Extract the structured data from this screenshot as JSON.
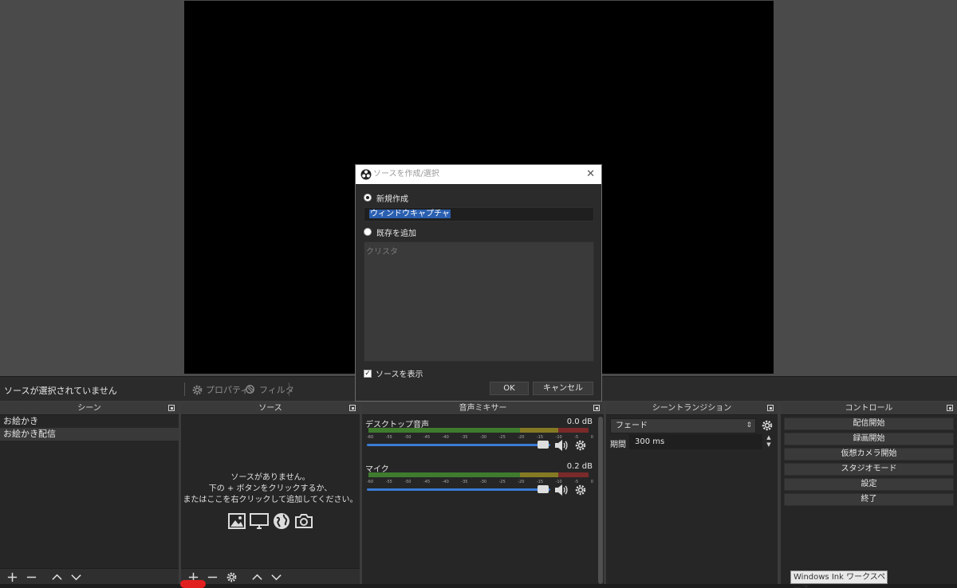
{
  "context_bar": {
    "status": "ソースが選択されていません",
    "properties_label": "プロパティ",
    "filters_label": "フィルタ"
  },
  "docks": {
    "scenes": {
      "title": "シーン",
      "items": [
        "お絵かき",
        "お絵かき配信"
      ],
      "selected_index": 1
    },
    "sources": {
      "title": "ソース",
      "empty_line1": "ソースがありません。",
      "empty_line2": "下の + ボタンをクリックするか、",
      "empty_line3": "またはここを右クリックして追加してください。"
    },
    "mixer": {
      "title": "音声ミキサー",
      "channels": [
        {
          "name": "デスクトップ音声",
          "db": "0.0 dB"
        },
        {
          "name": "マイク",
          "db": "0.2 dB"
        }
      ],
      "ticks": [
        "-60",
        "-55",
        "-50",
        "-45",
        "-40",
        "-35",
        "-30",
        "-25",
        "-20",
        "-15",
        "-10",
        "-5",
        "0"
      ]
    },
    "transitions": {
      "title": "シーントランジション",
      "selected": "フェード",
      "duration_label": "期間",
      "duration_value": "300 ms"
    },
    "controls": {
      "title": "コントロール",
      "buttons": [
        "配信開始",
        "録画開始",
        "仮想カメラ開始",
        "スタジオモード",
        "設定",
        "終了"
      ]
    }
  },
  "dialog": {
    "title": "ソースを作成/選択",
    "close_glyph": "✕",
    "option_new": "新規作成",
    "name_value": "ウィンドウキャプチャ",
    "option_existing": "既存を追加",
    "existing_items": [
      "クリスタ"
    ],
    "visible_label": "ソースを表示",
    "visible_checked": true,
    "ok_label": "OK",
    "cancel_label": "キャンセル"
  },
  "tooltip": "Windows Ink ワークスペース",
  "colors": {
    "preview_bg": "#4a4a4a",
    "dock_bg": "#262626",
    "meter_green": "#3f7b2e",
    "meter_yellow": "#857a24",
    "meter_red": "#7a2a2a",
    "slider_blue": "#3a7bd5",
    "highlight_red": "#e21f1f"
  }
}
